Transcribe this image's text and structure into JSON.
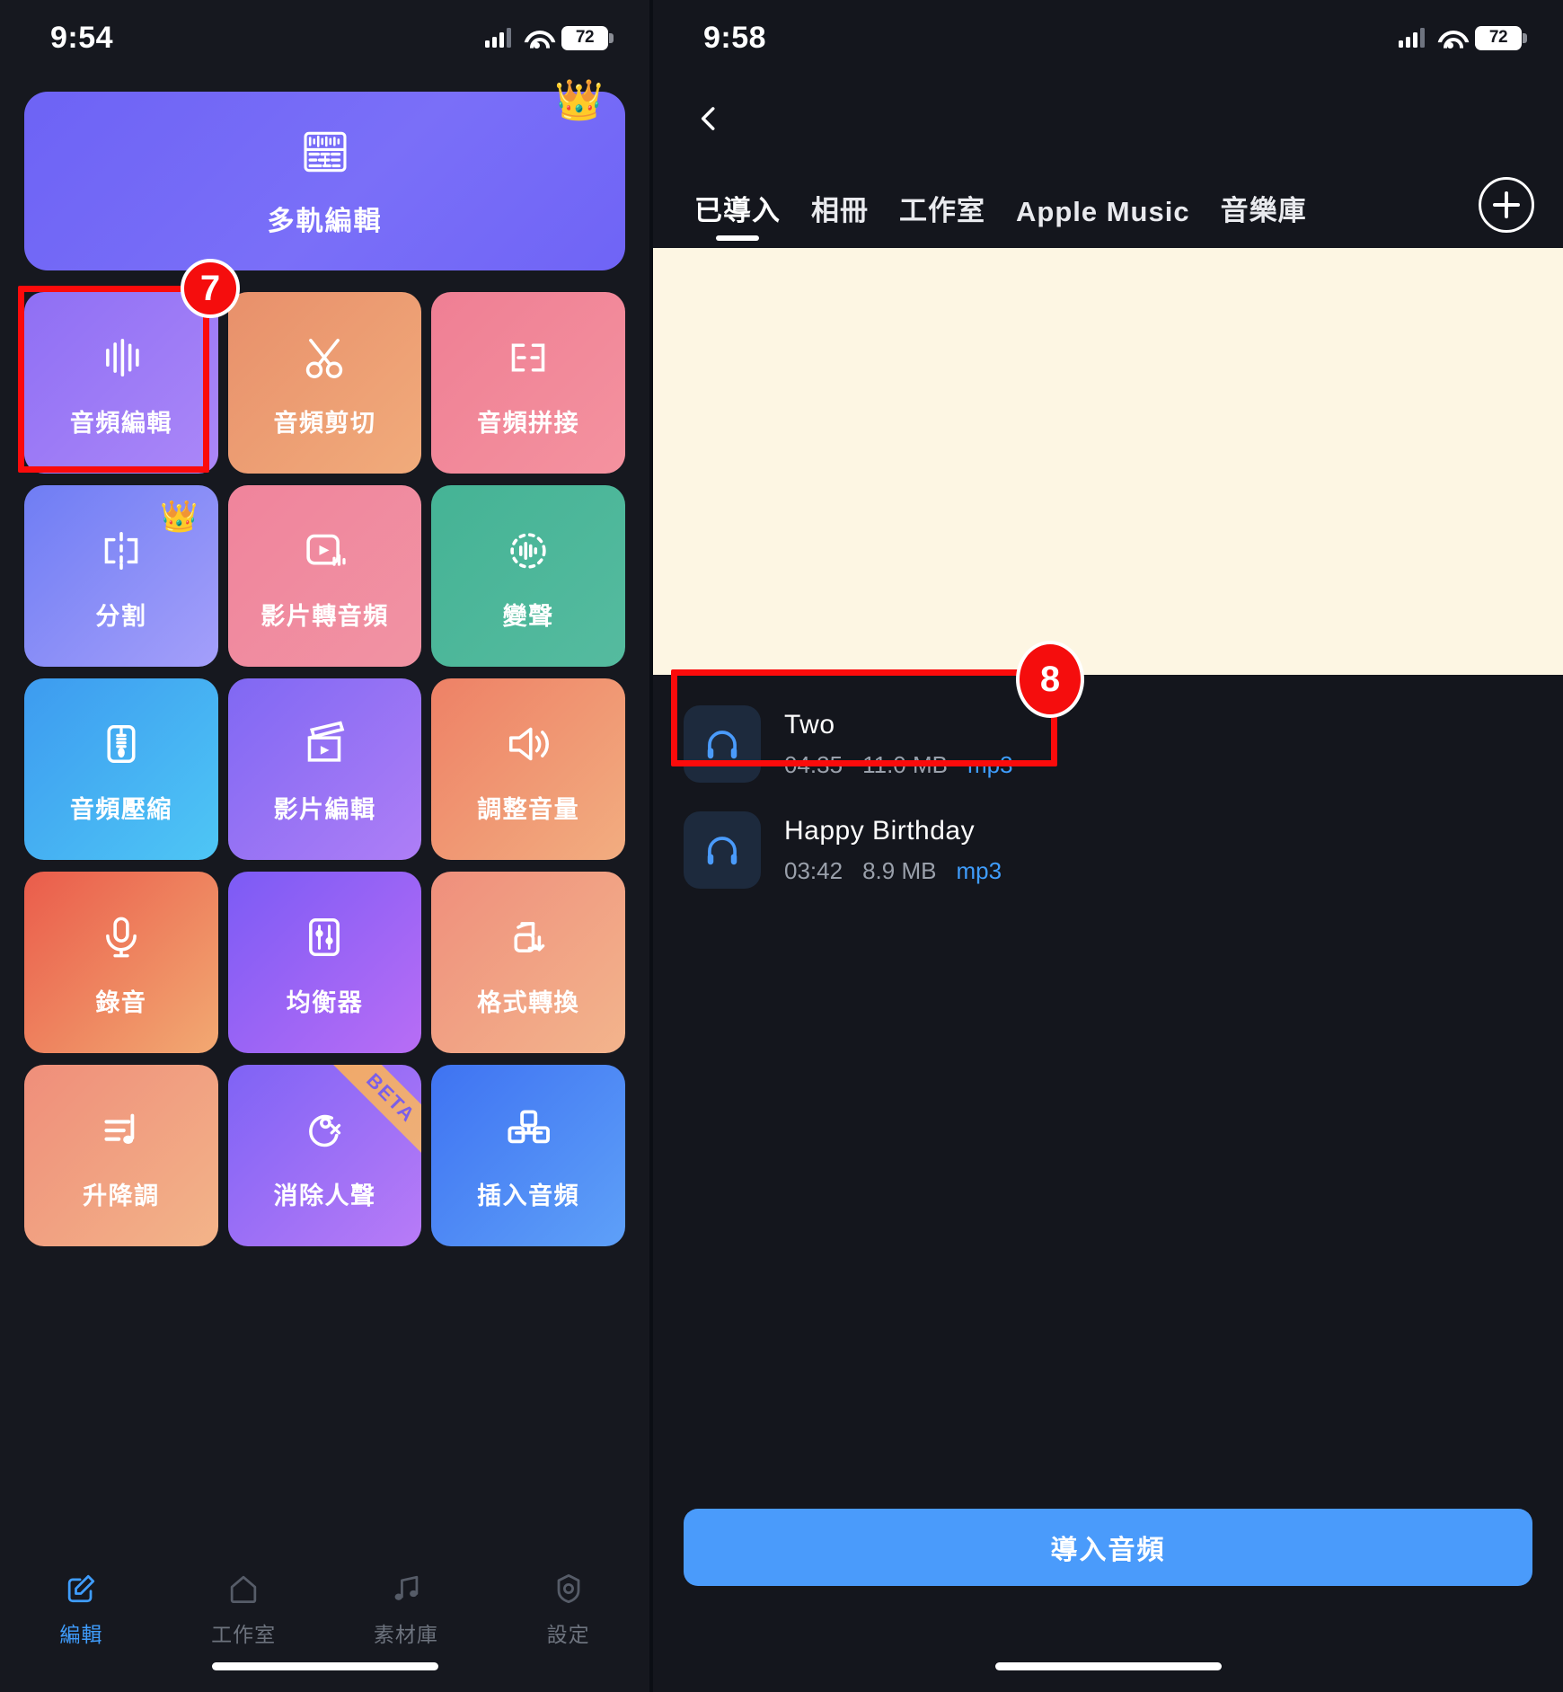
{
  "left": {
    "status": {
      "time": "9:54",
      "battery": "72"
    },
    "hero": {
      "label": "多軌編輯",
      "icon": "multitrack-icon",
      "badge": "crown-icon"
    },
    "tiles": [
      {
        "label": "音頻編輯",
        "icon": "waveform-icon",
        "c1": "#8f6ff4",
        "c2": "#a986f8",
        "badge": ""
      },
      {
        "label": "音頻剪切",
        "icon": "scissors-icon",
        "c1": "#e8906b",
        "c2": "#f0a878",
        "badge": ""
      },
      {
        "label": "音頻拼接",
        "icon": "merge-icon",
        "c1": "#ef7f94",
        "c2": "#f4909f",
        "badge": ""
      },
      {
        "label": "分割",
        "icon": "split-icon",
        "c1": "#6f7df4",
        "c2": "#a09cfa",
        "badge": "crown"
      },
      {
        "label": "影片轉音頻",
        "icon": "video-to-audio-icon",
        "c1": "#f0849c",
        "c2": "#f08fa0",
        "badge": ""
      },
      {
        "label": "變聲",
        "icon": "voice-changer-icon",
        "c1": "#45b395",
        "c2": "#52b89c",
        "badge": ""
      },
      {
        "label": "音頻壓縮",
        "icon": "compress-icon",
        "c1": "#3d9bf0",
        "c2": "#4cc3f4",
        "badge": ""
      },
      {
        "label": "影片編輯",
        "icon": "clapperboard-icon",
        "c1": "#8068f3",
        "c2": "#ad7cf6",
        "badge": ""
      },
      {
        "label": "調整音量",
        "icon": "volume-icon",
        "c1": "#ee8166",
        "c2": "#f1a97e",
        "badge": ""
      },
      {
        "label": "錄音",
        "icon": "microphone-icon",
        "c1": "#ea5c4b",
        "c2": "#f0a46f",
        "badge": ""
      },
      {
        "label": "均衡器",
        "icon": "equalizer-icon",
        "c1": "#7c5bf5",
        "c2": "#b66cf5",
        "badge": ""
      },
      {
        "label": "格式轉換",
        "icon": "format-convert-icon",
        "c1": "#ef8f7c",
        "c2": "#f2b088",
        "badge": ""
      },
      {
        "label": "升降調",
        "icon": "pitch-icon",
        "c1": "#ef8e7a",
        "c2": "#f2b086",
        "badge": ""
      },
      {
        "label": "消除人聲",
        "icon": "remove-vocals-icon",
        "c1": "#7f63f5",
        "c2": "#b579f7",
        "badge": "beta",
        "badge_text": "BETA"
      },
      {
        "label": "插入音頻",
        "icon": "insert-audio-icon",
        "c1": "#3f73f2",
        "c2": "#5a9cf8",
        "badge": ""
      }
    ],
    "tabbar": [
      {
        "label": "編輯",
        "icon": "edit-icon",
        "active": true
      },
      {
        "label": "工作室",
        "icon": "home-icon",
        "active": false
      },
      {
        "label": "素材庫",
        "icon": "music-library-icon",
        "active": false
      },
      {
        "label": "設定",
        "icon": "settings-gear-icon",
        "active": false
      }
    ]
  },
  "right": {
    "status": {
      "time": "9:58",
      "battery": "72"
    },
    "back_icon": "chevron-left-icon",
    "add_icon": "plus-circle-icon",
    "tabs": [
      {
        "label": "已導入",
        "active": true
      },
      {
        "label": "相冊",
        "active": false
      },
      {
        "label": "工作室",
        "active": false
      },
      {
        "label": "Apple Music",
        "active": false
      },
      {
        "label": "音樂庫",
        "active": false
      }
    ],
    "audio_items": [
      {
        "title": "Two",
        "duration": "04:35",
        "size": "11.0 MB",
        "format": "mp3",
        "icon": "headphones-icon"
      },
      {
        "title": "Happy Birthday",
        "duration": "03:42",
        "size": "8.9 MB",
        "format": "mp3",
        "icon": "headphones-icon"
      }
    ],
    "import_button": "導入音頻"
  },
  "annotations": [
    {
      "number": "7",
      "target": "音頻編輯"
    },
    {
      "number": "8",
      "target": "Two"
    }
  ],
  "colors": {
    "accent_blue": "#3f9dfd",
    "annotation_red": "#f50d0d",
    "background_dark": "#16181f",
    "ad_background": "#fdf6e3"
  }
}
